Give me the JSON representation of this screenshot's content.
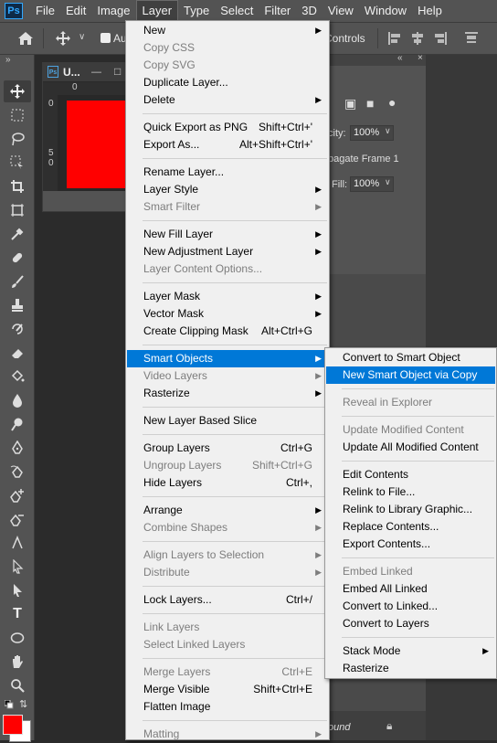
{
  "app": {
    "logo": "Ps",
    "menubar": [
      "File",
      "Edit",
      "Image",
      "Layer",
      "Type",
      "Select",
      "Filter",
      "3D",
      "View",
      "Window",
      "Help"
    ],
    "active_menu": "Layer"
  },
  "options_bar": {
    "auto_select_label": "Au",
    "controls_label": "Controls"
  },
  "document": {
    "tab_title": "U...",
    "ruler_top": "0",
    "ruler_left": [
      "0",
      "5",
      "0"
    ]
  },
  "right_panel": {
    "opacity_label": "city:",
    "opacity_value": "100%",
    "propagate_label": "pagate Frame 1",
    "fill_label": "Fill:",
    "fill_value": "100%",
    "bottom_layer_text": "ound"
  },
  "layer_menu": {
    "items": [
      {
        "label": "New",
        "submenu": true
      },
      {
        "label": "Copy CSS",
        "disabled": true
      },
      {
        "label": "Copy SVG",
        "disabled": true
      },
      {
        "label": "Duplicate Layer..."
      },
      {
        "label": "Delete",
        "submenu": true
      },
      {
        "sep": true
      },
      {
        "label": "Quick Export as PNG",
        "shortcut": "Shift+Ctrl+'"
      },
      {
        "label": "Export As...",
        "shortcut": "Alt+Shift+Ctrl+'"
      },
      {
        "sep": true
      },
      {
        "label": "Rename Layer..."
      },
      {
        "label": "Layer Style",
        "submenu": true
      },
      {
        "label": "Smart Filter",
        "submenu": true,
        "disabled": true
      },
      {
        "sep": true
      },
      {
        "label": "New Fill Layer",
        "submenu": true
      },
      {
        "label": "New Adjustment Layer",
        "submenu": true
      },
      {
        "label": "Layer Content Options...",
        "disabled": true
      },
      {
        "sep": true
      },
      {
        "label": "Layer Mask",
        "submenu": true
      },
      {
        "label": "Vector Mask",
        "submenu": true
      },
      {
        "label": "Create Clipping Mask",
        "shortcut": "Alt+Ctrl+G"
      },
      {
        "sep": true
      },
      {
        "label": "Smart Objects",
        "submenu": true,
        "highlighted": true
      },
      {
        "label": "Video Layers",
        "submenu": true,
        "disabled": true
      },
      {
        "label": "Rasterize",
        "submenu": true
      },
      {
        "sep": true
      },
      {
        "label": "New Layer Based Slice"
      },
      {
        "sep": true
      },
      {
        "label": "Group Layers",
        "shortcut": "Ctrl+G"
      },
      {
        "label": "Ungroup Layers",
        "shortcut": "Shift+Ctrl+G",
        "disabled": true
      },
      {
        "label": "Hide Layers",
        "shortcut": "Ctrl+,"
      },
      {
        "sep": true
      },
      {
        "label": "Arrange",
        "submenu": true
      },
      {
        "label": "Combine Shapes",
        "submenu": true,
        "disabled": true
      },
      {
        "sep": true
      },
      {
        "label": "Align Layers to Selection",
        "submenu": true,
        "disabled": true
      },
      {
        "label": "Distribute",
        "submenu": true,
        "disabled": true
      },
      {
        "sep": true
      },
      {
        "label": "Lock Layers...",
        "shortcut": "Ctrl+/"
      },
      {
        "sep": true
      },
      {
        "label": "Link Layers",
        "disabled": true
      },
      {
        "label": "Select Linked Layers",
        "disabled": true
      },
      {
        "sep": true
      },
      {
        "label": "Merge Layers",
        "shortcut": "Ctrl+E",
        "disabled": true
      },
      {
        "label": "Merge Visible",
        "shortcut": "Shift+Ctrl+E"
      },
      {
        "label": "Flatten Image"
      },
      {
        "sep": true
      },
      {
        "label": "Matting",
        "submenu": true,
        "disabled": true
      }
    ]
  },
  "smart_objects_menu": {
    "items": [
      {
        "label": "Convert to Smart Object"
      },
      {
        "label": "New Smart Object via Copy",
        "highlighted": true
      },
      {
        "sep": true
      },
      {
        "label": "Reveal in Explorer",
        "disabled": true
      },
      {
        "sep": true
      },
      {
        "label": "Update Modified Content",
        "disabled": true
      },
      {
        "label": "Update All Modified Content"
      },
      {
        "sep": true
      },
      {
        "label": "Edit Contents"
      },
      {
        "label": "Relink to File..."
      },
      {
        "label": "Relink to Library Graphic..."
      },
      {
        "label": "Replace Contents..."
      },
      {
        "label": "Export Contents..."
      },
      {
        "sep": true
      },
      {
        "label": "Embed Linked",
        "disabled": true
      },
      {
        "label": "Embed All Linked"
      },
      {
        "label": "Convert to Linked..."
      },
      {
        "label": "Convert to Layers"
      },
      {
        "sep": true
      },
      {
        "label": "Stack Mode",
        "submenu": true
      },
      {
        "label": "Rasterize"
      }
    ]
  },
  "colors": {
    "foreground": "#ff0000",
    "background": "#ffffff",
    "highlight": "#0078d7",
    "canvas_fill": "#ff0000"
  }
}
